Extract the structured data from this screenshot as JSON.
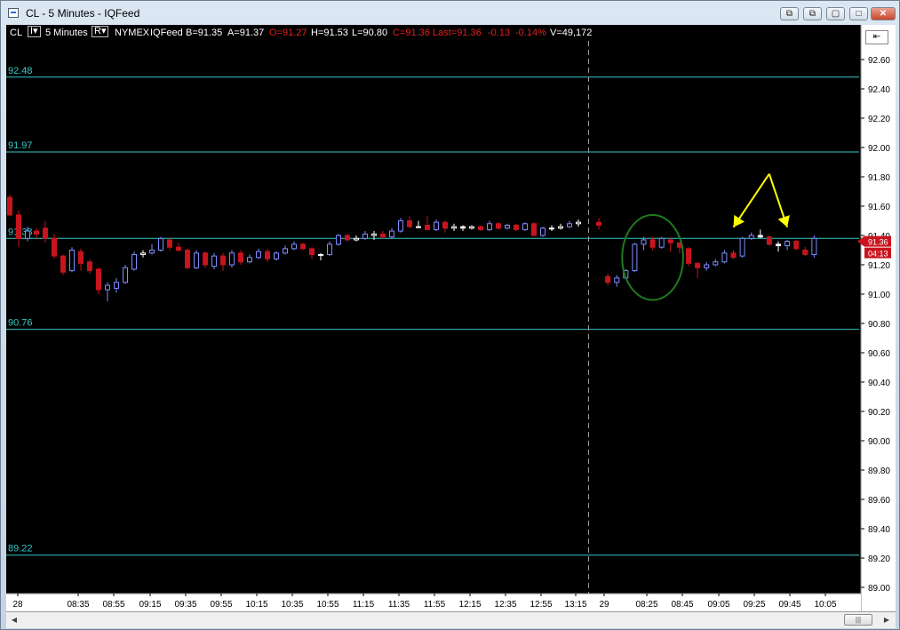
{
  "window": {
    "title": "CL - 5 Minutes - IQFeed",
    "buttons": [
      "⧉",
      "⧉",
      "▢",
      "□",
      "✕"
    ]
  },
  "infobar": {
    "symbol": "CL",
    "btn1": "I▾",
    "interval": "5 Minutes",
    "btn2": "R▾",
    "exchange": "NYMEX",
    "feed": "IQFeed",
    "bid": "B=91.35",
    "ask": "A=91.37",
    "open": "O=91.27",
    "high": "H=91.53",
    "low": "L=90.80",
    "close": "C=91.36",
    "last": "Last=91.36",
    "change": "-0.13",
    "change_pct": "-0.14%",
    "volume": "V=49,172",
    "scale_button": "⇤"
  },
  "colors": {
    "up": "#7f8cff",
    "down": "#c8141e",
    "doji": "#ffffff",
    "hline": "#39c6c6",
    "annotation_circle": "#1f7a1f",
    "annotation_arrow": "#ffff00",
    "last_price_tag": "#c8141e"
  },
  "chart_data": {
    "type": "candlestick",
    "ylim": [
      88.92,
      92.68
    ],
    "yticks": [
      "92.60",
      "92.40",
      "92.20",
      "92.00",
      "91.80",
      "91.60",
      "91.40",
      "91.20",
      "91.00",
      "90.80",
      "90.60",
      "90.40",
      "90.20",
      "90.00",
      "89.80",
      "89.60",
      "89.40",
      "89.20",
      "89.00"
    ],
    "xticks": [
      "28",
      "08:35",
      "08:55",
      "09:15",
      "09:35",
      "09:55",
      "10:15",
      "10:35",
      "10:55",
      "11:15",
      "11:35",
      "11:55",
      "12:15",
      "12:35",
      "12:55",
      "13:15",
      "29",
      "08:25",
      "08:45",
      "09:05",
      "09:25",
      "09:45",
      "10:05"
    ],
    "hlines": [
      {
        "label": "92.48",
        "value": 92.48
      },
      {
        "label": "91.97",
        "value": 91.97
      },
      {
        "label": "91.38",
        "value": 91.38
      },
      {
        "label": "90.76",
        "value": 90.76
      },
      {
        "label": "89.22",
        "value": 89.22
      }
    ],
    "price_tags": [
      "91.36",
      "04:13"
    ],
    "session_break_after_candle": 65,
    "annotations": [
      {
        "type": "circle",
        "from_candle": 68,
        "to_candle": 74,
        "low": 90.96,
        "high": 91.54
      },
      {
        "type": "arrow",
        "to_candle": 80,
        "to_price": 91.42
      },
      {
        "type": "arrow",
        "to_candle": 86,
        "to_price": 91.42
      }
    ],
    "candles": [
      [
        91.66,
        91.54,
        91.68,
        91.53
      ],
      [
        91.54,
        91.38,
        91.57,
        91.32
      ],
      [
        91.38,
        91.43,
        91.46,
        91.36
      ],
      [
        91.43,
        91.41,
        91.45,
        91.38
      ],
      [
        91.45,
        91.38,
        91.5,
        91.35
      ],
      [
        91.38,
        91.26,
        91.41,
        91.24
      ],
      [
        91.26,
        91.15,
        91.27,
        91.13
      ],
      [
        91.16,
        91.3,
        91.32,
        91.15
      ],
      [
        91.29,
        91.21,
        91.31,
        91.16
      ],
      [
        91.22,
        91.16,
        91.24,
        91.14
      ],
      [
        91.17,
        91.03,
        91.18,
        91.0
      ],
      [
        91.03,
        91.06,
        91.08,
        90.95
      ],
      [
        91.04,
        91.08,
        91.11,
        91.01
      ],
      [
        91.08,
        91.18,
        91.2,
        91.07
      ],
      [
        91.17,
        91.27,
        91.29,
        91.16
      ],
      [
        91.27,
        91.28,
        91.3,
        91.25
      ],
      [
        91.28,
        91.3,
        91.34,
        91.27
      ],
      [
        91.3,
        91.38,
        91.39,
        91.29
      ],
      [
        91.37,
        91.32,
        91.38,
        91.3
      ],
      [
        91.32,
        91.3,
        91.35,
        91.29
      ],
      [
        91.3,
        91.18,
        91.31,
        91.17
      ],
      [
        91.18,
        91.28,
        91.3,
        91.17
      ],
      [
        91.28,
        91.2,
        91.29,
        91.18
      ],
      [
        91.19,
        91.26,
        91.28,
        91.17
      ],
      [
        91.26,
        91.2,
        91.28,
        91.16
      ],
      [
        91.2,
        91.28,
        91.3,
        91.18
      ],
      [
        91.28,
        91.22,
        91.3,
        91.2
      ],
      [
        91.22,
        91.25,
        91.27,
        91.21
      ],
      [
        91.25,
        91.29,
        91.31,
        91.24
      ],
      [
        91.29,
        91.24,
        91.31,
        91.22
      ],
      [
        91.24,
        91.28,
        91.29,
        91.23
      ],
      [
        91.28,
        91.31,
        91.33,
        91.27
      ],
      [
        91.31,
        91.34,
        91.36,
        91.3
      ],
      [
        91.34,
        91.31,
        91.35,
        91.3
      ],
      [
        91.31,
        91.27,
        91.32,
        91.24
      ],
      [
        91.27,
        91.27,
        91.28,
        91.23
      ],
      [
        91.27,
        91.34,
        91.36,
        91.26
      ],
      [
        91.34,
        91.4,
        91.41,
        91.33
      ],
      [
        91.4,
        91.37,
        91.41,
        91.36
      ],
      [
        91.37,
        91.38,
        91.4,
        91.36
      ],
      [
        91.38,
        91.41,
        91.43,
        91.37
      ],
      [
        91.4,
        91.41,
        91.43,
        91.37
      ],
      [
        91.41,
        91.39,
        91.43,
        91.38
      ],
      [
        91.39,
        91.43,
        91.45,
        91.38
      ],
      [
        91.43,
        91.5,
        91.52,
        91.42
      ],
      [
        91.5,
        91.46,
        91.53,
        91.45
      ],
      [
        91.46,
        91.46,
        91.5,
        91.45
      ],
      [
        91.47,
        91.44,
        91.53,
        91.44
      ],
      [
        91.44,
        91.49,
        91.51,
        91.43
      ],
      [
        91.49,
        91.45,
        91.5,
        91.42
      ],
      [
        91.45,
        91.46,
        91.48,
        91.43
      ],
      [
        91.46,
        91.45,
        91.47,
        91.43
      ],
      [
        91.45,
        91.46,
        91.47,
        91.44
      ],
      [
        91.46,
        91.44,
        91.47,
        91.43
      ],
      [
        91.44,
        91.48,
        91.5,
        91.43
      ],
      [
        91.48,
        91.45,
        91.49,
        91.44
      ],
      [
        91.45,
        91.47,
        91.48,
        91.44
      ],
      [
        91.47,
        91.44,
        91.48,
        91.43
      ],
      [
        91.44,
        91.48,
        91.49,
        91.43
      ],
      [
        91.48,
        91.4,
        91.49,
        91.4
      ],
      [
        91.4,
        91.45,
        91.46,
        91.39
      ],
      [
        91.45,
        91.45,
        91.47,
        91.43
      ],
      [
        91.45,
        91.46,
        91.48,
        91.44
      ],
      [
        91.46,
        91.48,
        91.5,
        91.45
      ],
      [
        91.48,
        91.49,
        91.51,
        91.46
      ],
      [
        91.49,
        91.47,
        91.52,
        91.44
      ],
      [
        91.12,
        91.08,
        91.14,
        91.06
      ],
      [
        91.08,
        91.11,
        91.13,
        91.05
      ],
      [
        91.11,
        91.16,
        91.17,
        91.1
      ],
      [
        91.16,
        91.34,
        91.35,
        91.15
      ],
      [
        91.34,
        91.37,
        91.39,
        91.3
      ],
      [
        91.37,
        91.32,
        91.39,
        91.3
      ],
      [
        91.32,
        91.38,
        91.39,
        91.31
      ],
      [
        91.37,
        91.35,
        91.38,
        91.29
      ],
      [
        91.35,
        91.32,
        91.35,
        91.28
      ],
      [
        91.31,
        91.21,
        91.32,
        91.19
      ],
      [
        91.21,
        91.18,
        91.22,
        91.11
      ],
      [
        91.18,
        91.2,
        91.22,
        91.16
      ],
      [
        91.2,
        91.22,
        91.24,
        91.19
      ],
      [
        91.22,
        91.28,
        91.3,
        91.21
      ],
      [
        91.28,
        91.25,
        91.3,
        91.24
      ],
      [
        91.26,
        91.38,
        91.39,
        91.25
      ],
      [
        91.38,
        91.4,
        91.42,
        91.37
      ],
      [
        91.4,
        91.39,
        91.44,
        91.38
      ],
      [
        91.39,
        91.34,
        91.4,
        91.33
      ],
      [
        91.34,
        91.33,
        91.36,
        91.29
      ],
      [
        91.33,
        91.36,
        91.37,
        91.3
      ],
      [
        91.36,
        91.31,
        91.37,
        91.3
      ],
      [
        91.3,
        91.27,
        91.32,
        91.26
      ],
      [
        91.27,
        91.38,
        91.4,
        91.25
      ]
    ]
  }
}
